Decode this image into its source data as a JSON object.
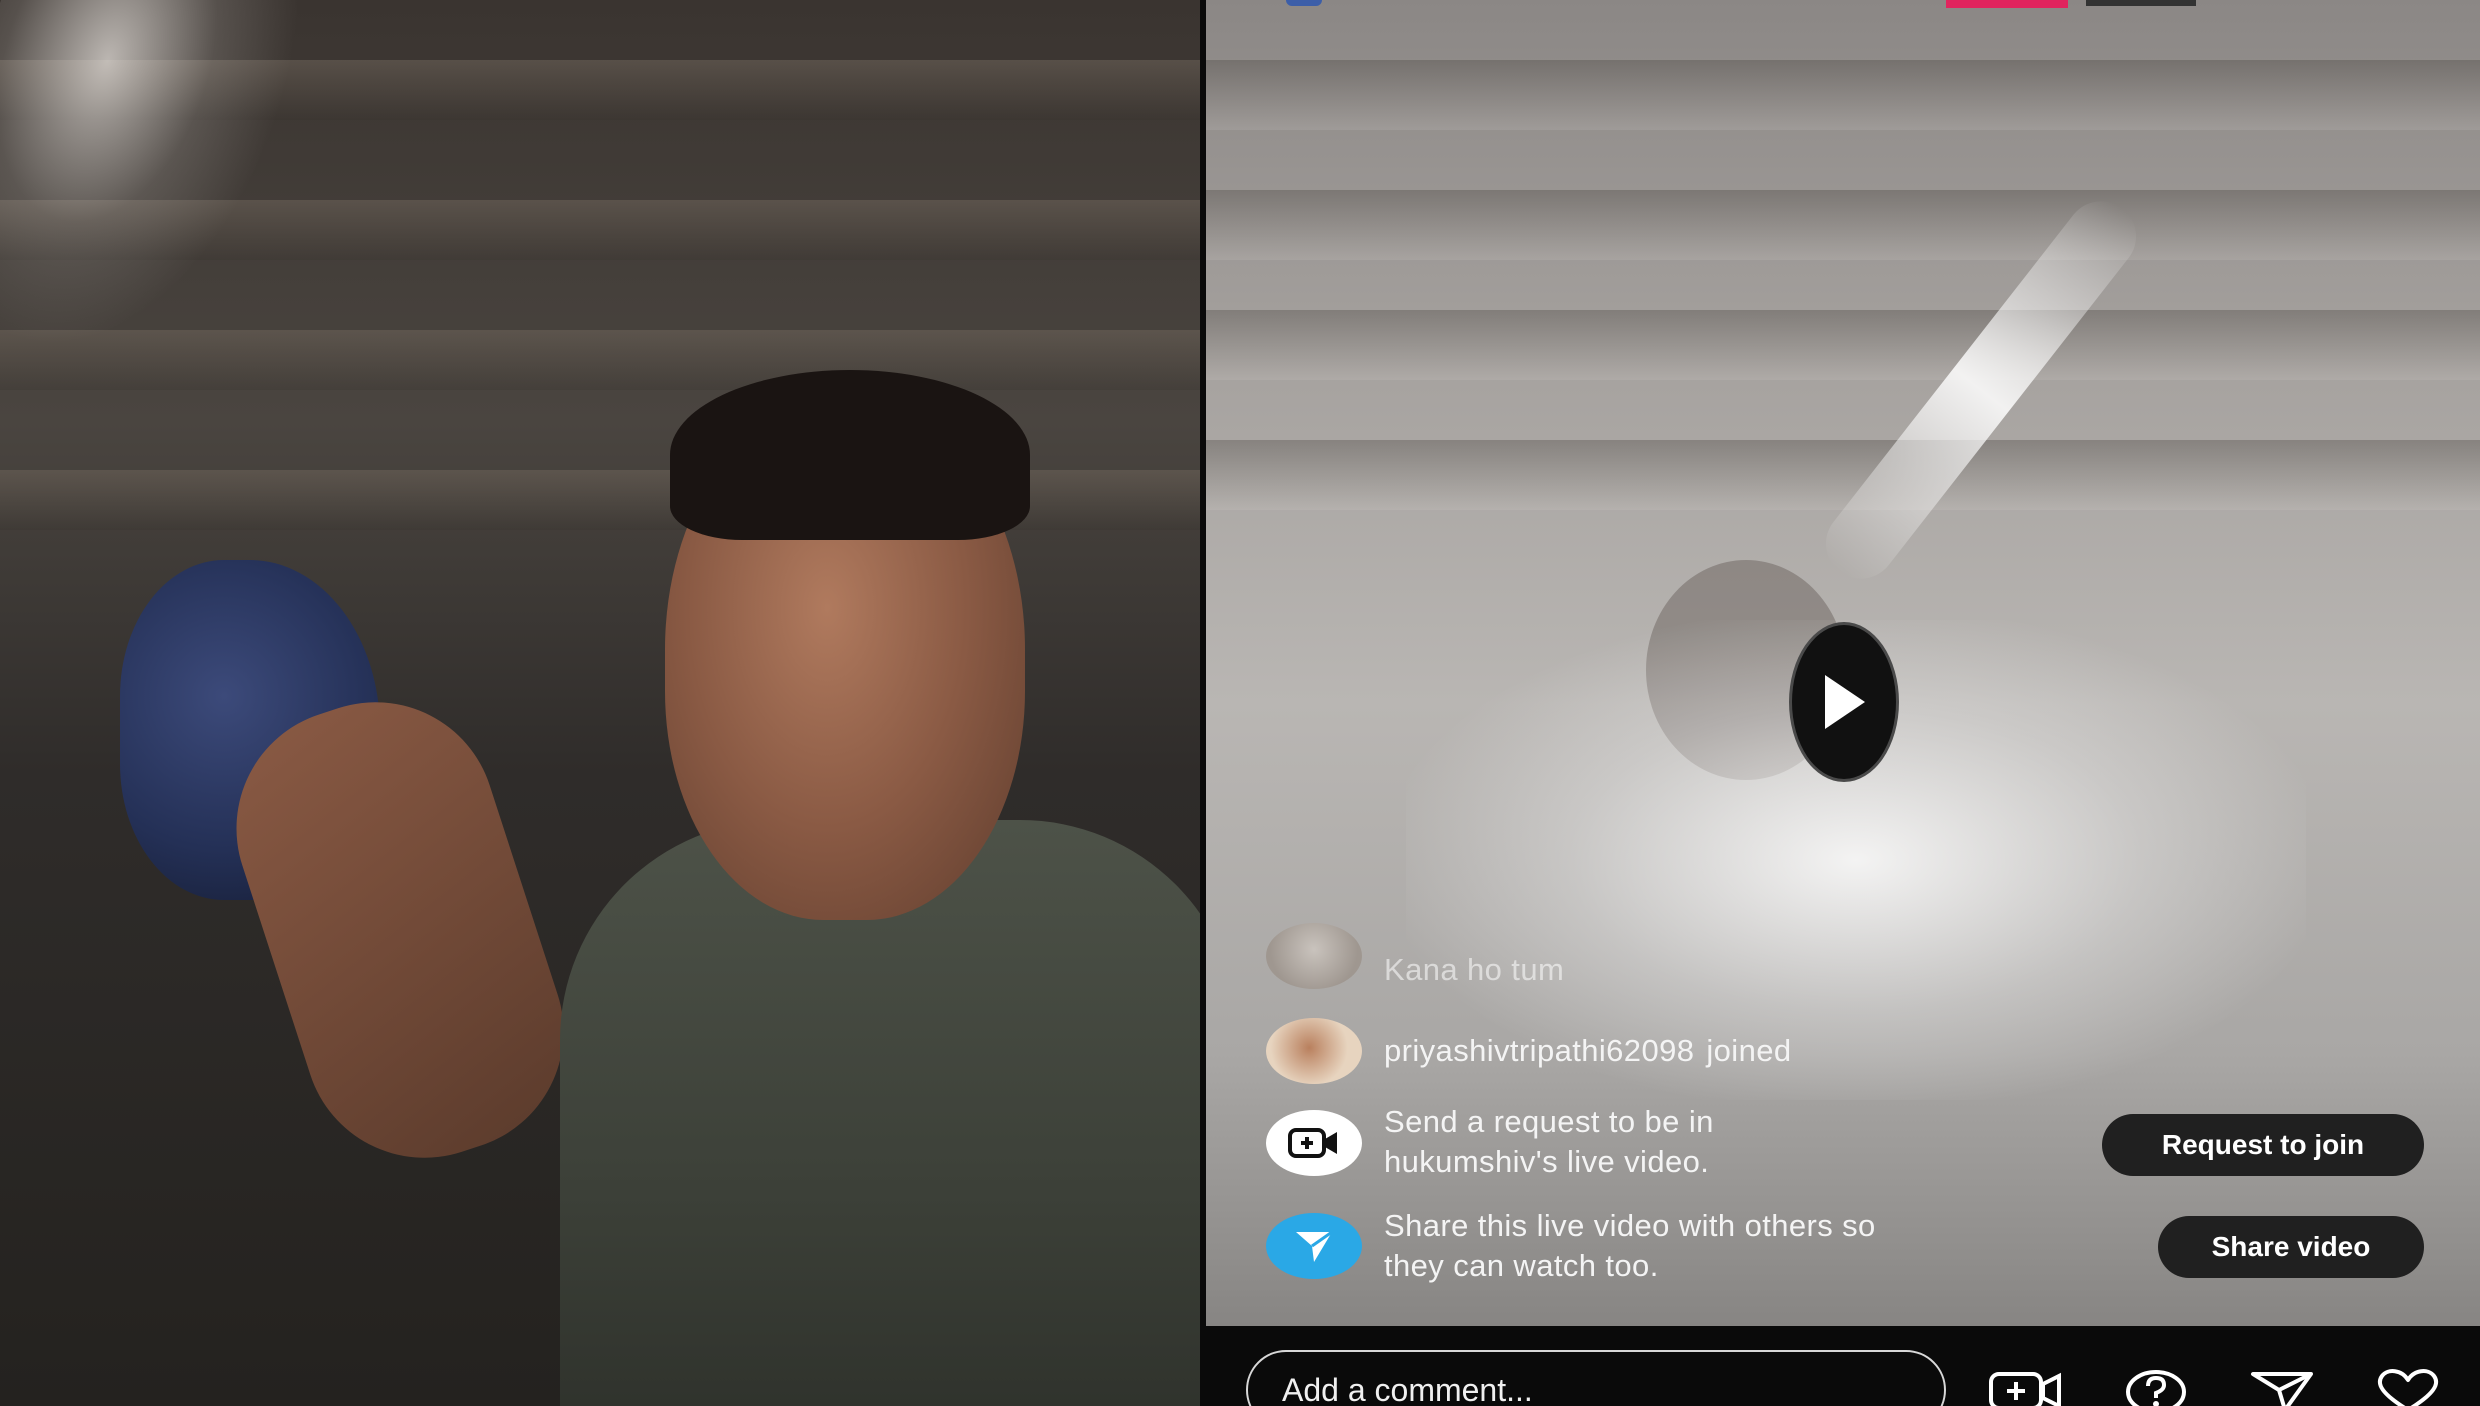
{
  "live": {
    "comments": [
      {
        "username": "",
        "text": "Kana ho tum",
        "avatar": "user-avatar"
      },
      {
        "username": "priyashivtripathi62098",
        "text": "joined",
        "avatar": "user-avatar"
      }
    ],
    "request_prompt": {
      "line1": "Send a request to be in",
      "line2": "hukumshiv's live video.",
      "button": "Request to join",
      "icon": "add-video-icon"
    },
    "share_prompt": {
      "line1": "Share this live video with others so",
      "line2": "they can watch too.",
      "button": "Share video",
      "icon": "send-icon"
    },
    "comment_placeholder": "Add a comment...",
    "bottom_icons": [
      "add-video-icon",
      "question-icon",
      "send-icon",
      "heart-icon"
    ],
    "play_icon": "play-icon"
  },
  "colors": {
    "live_pink": "#e0245e",
    "share_blue": "#2aa8e6",
    "pill_bg": "#202020"
  }
}
